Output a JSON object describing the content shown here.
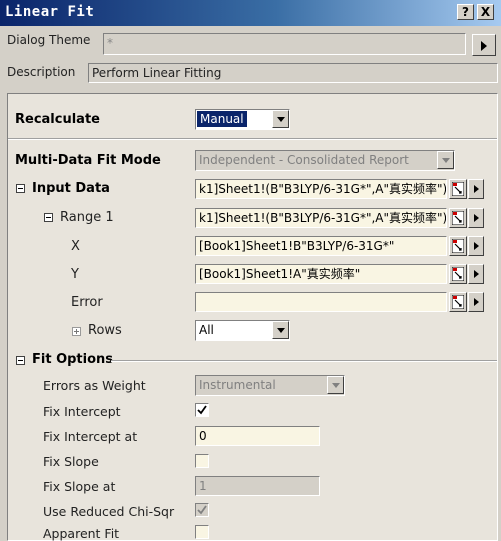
{
  "window": {
    "title": "Linear Fit",
    "help_label": "?",
    "close_label": "X"
  },
  "theme": {
    "label": "Dialog Theme",
    "value": "*"
  },
  "description": {
    "label": "Description",
    "value": "Perform Linear Fitting"
  },
  "recalculate": {
    "label": "Recalculate",
    "value": "Manual"
  },
  "multi_fit": {
    "label": "Multi-Data Fit Mode",
    "value": "Independent - Consolidated Report"
  },
  "input_data": {
    "label": "Input Data",
    "value": "k1]Sheet1!(B\"B3LYP/6-31G*\",A\"真实频率\")",
    "range": {
      "label": "Range 1",
      "value": "k1]Sheet1!(B\"B3LYP/6-31G*\",A\"真实频率\")",
      "x": {
        "label": "X",
        "value": "[Book1]Sheet1!B\"B3LYP/6-31G*\""
      },
      "y": {
        "label": "Y",
        "value": "[Book1]Sheet1!A\"真实频率\""
      },
      "error": {
        "label": "Error",
        "value": ""
      },
      "rows": {
        "label": "Rows",
        "value": "All"
      }
    }
  },
  "fit_options": {
    "label": "Fit Options",
    "errors_weight": {
      "label": "Errors as Weight",
      "value": "Instrumental"
    },
    "fix_intercept": {
      "label": "Fix Intercept",
      "checked": true
    },
    "fix_intercept_at": {
      "label": "Fix Intercept at",
      "value": "0"
    },
    "fix_slope": {
      "label": "Fix Slope",
      "checked": false
    },
    "fix_slope_at": {
      "label": "Fix Slope at",
      "value": "1"
    },
    "reduced_chisqr": {
      "label": "Use Reduced Chi-Sqr",
      "checked": true
    },
    "apparent_fit": {
      "label": "Apparent Fit",
      "checked": false
    }
  }
}
